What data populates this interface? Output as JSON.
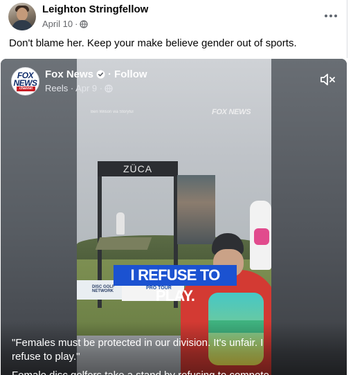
{
  "post": {
    "author": "Leighton Stringfellow",
    "date": "April 10",
    "separator": "·",
    "privacy_icon": "globe-icon",
    "more_icon": "more-horizontal-icon",
    "caption": "Don't blame her. Keep your make believe gender out of sports."
  },
  "video": {
    "channel_name": "Fox News",
    "verified_icon": "verified-badge-icon",
    "follow_separator": "·",
    "follow_label": "Follow",
    "meta": "Reels · Apr 9 ·",
    "privacy_icon": "globe-icon",
    "mute_icon": "speaker-muted-icon",
    "logo_text": "FOX NEWS",
    "logo_sub": "channel",
    "credit": "Ben Wilson via Storyful",
    "watermark": "FOX NEWS",
    "scene_sign": "ZÜCA",
    "banner_left_text": "DISC GOLF NETWORK",
    "banner_right_text": "PRO TOUR",
    "subtitle": "I REFUSE TO PLAY.",
    "quote": "\"Females must be protected in our division. It's unfair. I refuse to play.\"",
    "description_partial": "Female disc golfers take a stand by refusing to compete",
    "colors": {
      "subtitle_bg": "#1b52d1",
      "brand_red": "#c81d25",
      "text_secondary": "#65676b"
    }
  }
}
